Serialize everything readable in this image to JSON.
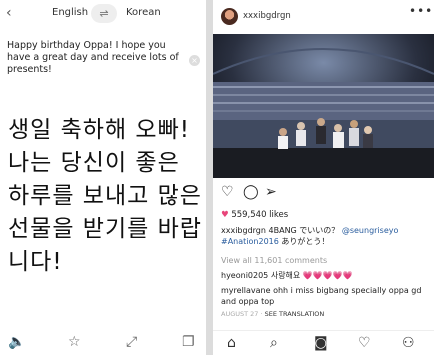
{
  "translator": {
    "back_icon": "‹",
    "source_lang": "English",
    "swap_icon": "⇌",
    "target_lang": "Korean",
    "source_text": "Happy birthday Oppa! I hope you have a great day and receive lots of presents!",
    "clear_icon": "×",
    "translated_text": "생일 축하해 오빠! 나는 당신이 좋은 하루를 보내고 많은 선물을 받기를 바랍니다!",
    "bottom_icons": [
      "speaker-icon",
      "star-icon",
      "expand-icon",
      "copy-icon"
    ]
  },
  "instagram": {
    "username": "xxxibgdrgn",
    "more_icon": "•••",
    "likes": "559,540 likes",
    "caption_user": "xxxibgdrgn",
    "caption_text": "4BANG でいいの？",
    "caption_mention": "@seungriseyo",
    "caption_hashtag": "#Anation2016",
    "caption_tail": "ありがとう！",
    "view_all": "View all 11,601 comments",
    "comment1_user": "hyeoni0205",
    "comment1_text": "사랑해요",
    "comment1_hearts": "💗💗💗💗💗",
    "comment2_user": "myrellavane",
    "comment2_text": "ohh i miss bigbang specially oppa gd and oppa top",
    "date": "AUGUST 27",
    "see_translation": "SEE TRANSLATION"
  },
  "colors": {
    "link": "#2a5d9e",
    "heart": "#e8457a"
  }
}
